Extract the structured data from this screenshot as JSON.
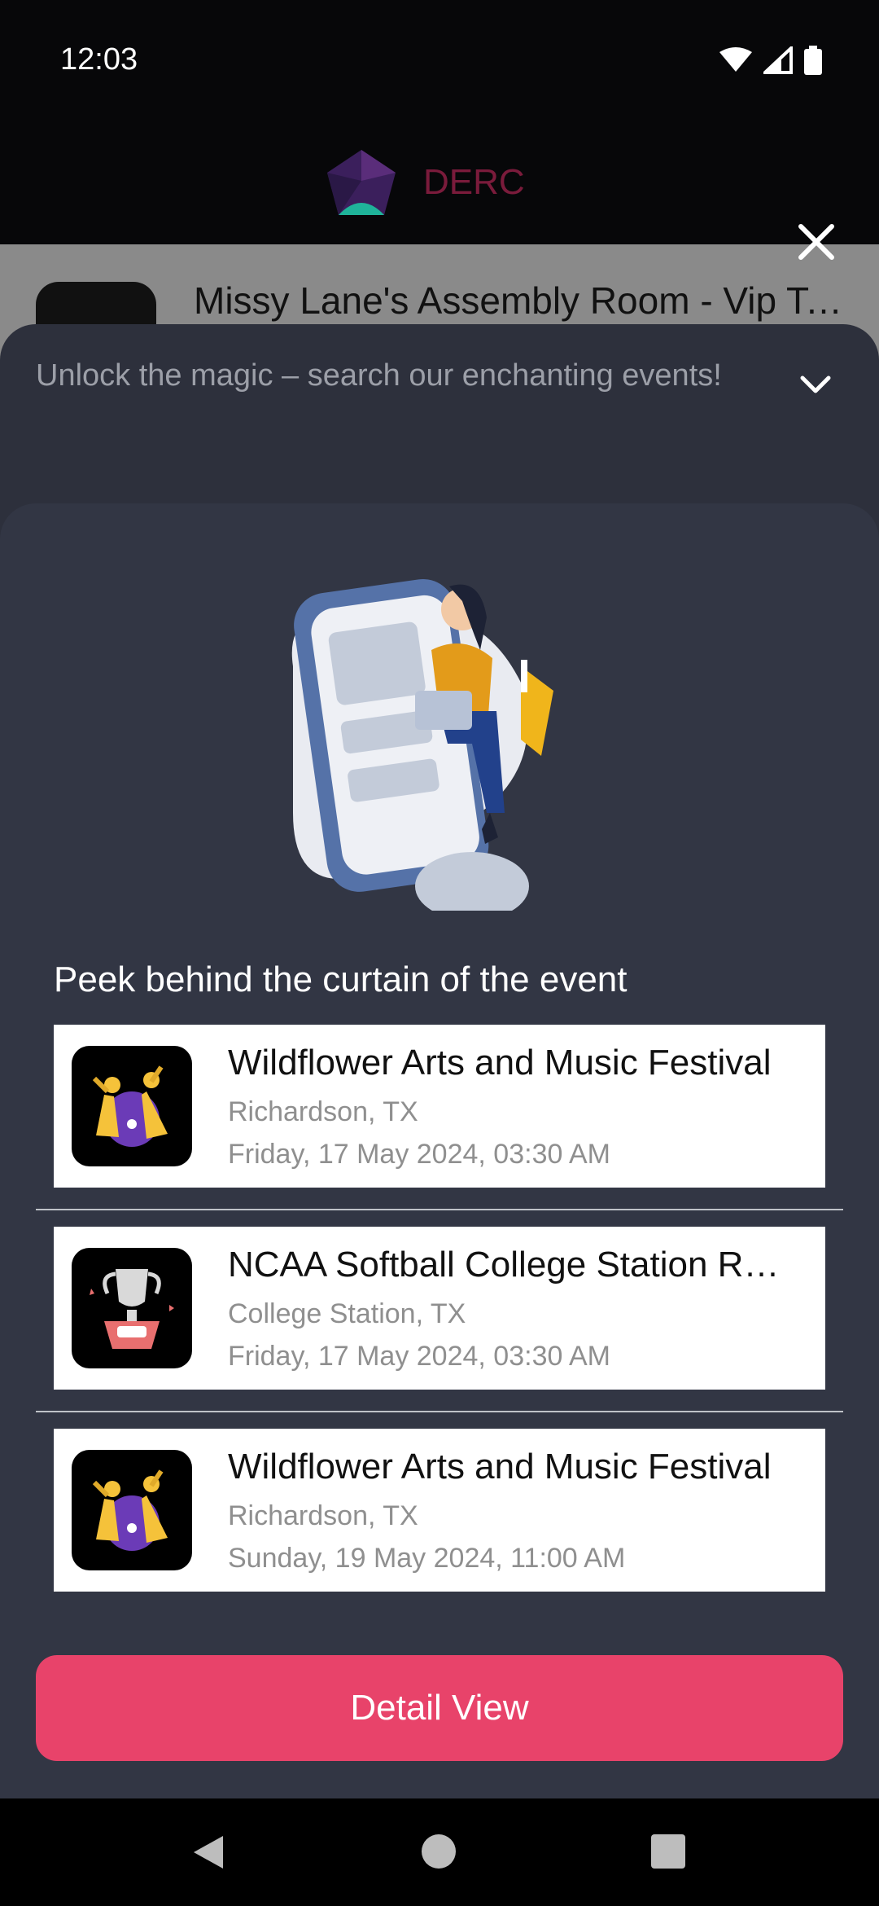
{
  "status_bar": {
    "time": "12:03"
  },
  "app_bar": {
    "brand": "DERC"
  },
  "behind_list": {
    "title": "Missy Lane's Assembly Room - Vip Table"
  },
  "sheet": {
    "header_text": "Unlock the magic – search our enchanting events!",
    "section_title": "Peek behind the curtain of the event",
    "events": [
      {
        "title": "Wildflower Arts and Music Festival",
        "location": "Richardson, TX",
        "date": "Friday, 17 May 2024, 03:30 AM",
        "thumb_icon": "festival-dancers-icon"
      },
      {
        "title": "NCAA Softball College Station Regional",
        "location": "College Station, TX",
        "date": "Friday, 17 May 2024, 03:30 AM",
        "thumb_icon": "trophy-icon"
      },
      {
        "title": "Wildflower Arts and Music Festival",
        "location": "Richardson, TX",
        "date": "Sunday, 19 May 2024, 11:00 AM",
        "thumb_icon": "festival-dancers-icon"
      }
    ],
    "button_label": "Detail View"
  },
  "colors": {
    "accent": "#e8436a",
    "sheet_bg": "#2d303c",
    "panel_bg": "#323644"
  }
}
